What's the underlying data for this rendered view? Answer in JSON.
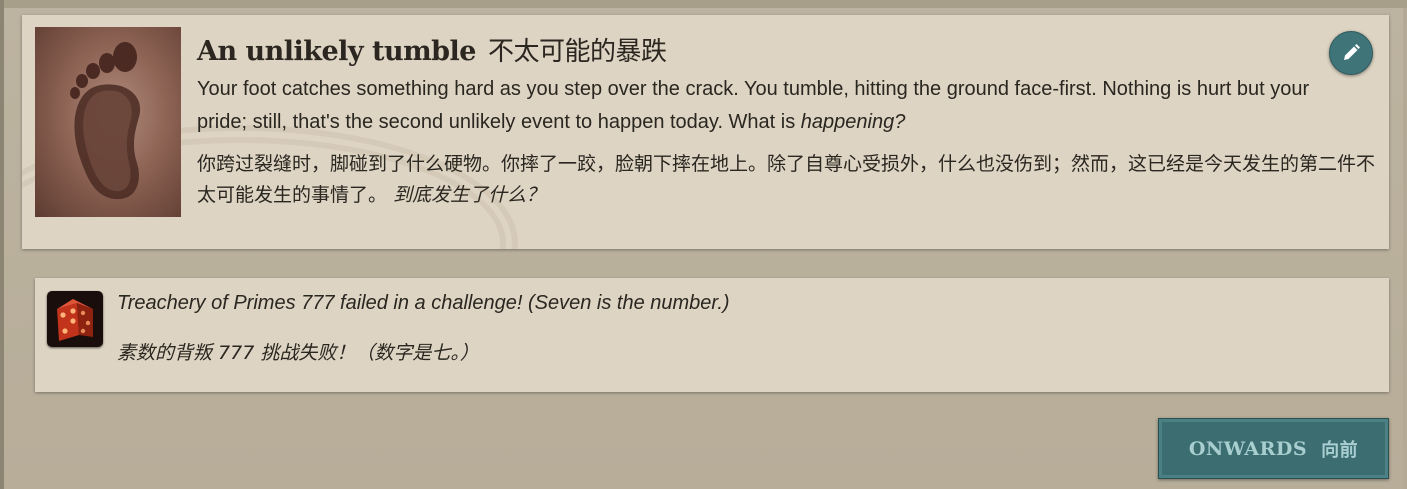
{
  "event": {
    "title_en": "An unlikely tumble",
    "title_cn": "不太可能的暴跌",
    "description_en": "Your foot catches something hard as you step over the crack. You tumble, hitting the ground face-first. Nothing is hurt but your pride; still, that's the second unlikely event to happen today. What is",
    "description_en_emphasis": "happening?",
    "description_cn": "你跨过裂缝时，脚碰到了什么硬物。你摔了一跤，脸朝下摔在地上。除了自尊心受损外，什么也没伤到；然而，这已经是今天发生的第二件不太可能发生的事情了。",
    "description_cn_emphasis": "到底发生了什么？",
    "image_icon": "footprint-icon"
  },
  "edit": {
    "icon": "pencil-icon"
  },
  "result": {
    "icon": "dice-icon",
    "text_en": "Treachery of Primes 777 failed in a challenge! (Seven is the number.)",
    "text_cn": "素数的背叛 777 挑战失败！（数字是七。）"
  },
  "onwards": {
    "label_en": "ONWARDS",
    "label_cn": "向前"
  },
  "colors": {
    "accent": "#3f7478",
    "card": "#ddd4c3",
    "background": "#b7ad99"
  }
}
